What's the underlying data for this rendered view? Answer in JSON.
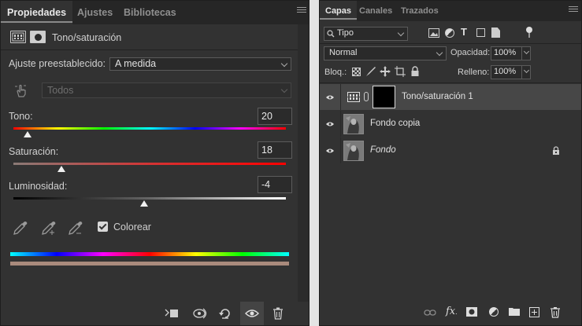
{
  "properties": {
    "tabs": [
      "Propiedades",
      "Ajustes",
      "Bibliotecas"
    ],
    "header_title": "Tono/saturación",
    "preset_label": "Ajuste preestablecido:",
    "preset_value": "A medida",
    "range_value": "Todos",
    "hue": {
      "label": "Tono:",
      "value": "20"
    },
    "saturation": {
      "label": "Saturación:",
      "value": "18"
    },
    "lightness": {
      "label": "Luminosidad:",
      "value": "-4"
    },
    "colorize_label": "Colorear",
    "colorize_checked": true
  },
  "layers": {
    "tabs": [
      "Capas",
      "Canales",
      "Trazados"
    ],
    "filter_value": "Tipo",
    "blend_mode": "Normal",
    "opacity_label": "Opacidad:",
    "opacity_value": "100%",
    "lock_label": "Bloq.:",
    "fill_label": "Relleno:",
    "fill_value": "100%",
    "items": [
      {
        "name": "Tono/saturación 1",
        "type": "adjustment",
        "selected": true
      },
      {
        "name": "Fondo copia",
        "type": "image",
        "selected": false
      },
      {
        "name": "Fondo",
        "type": "image",
        "selected": false,
        "locked": true
      }
    ]
  },
  "colors": {
    "panel_bg": "#323232",
    "tab_bg": "#262626",
    "selected_layer": "#474747"
  }
}
